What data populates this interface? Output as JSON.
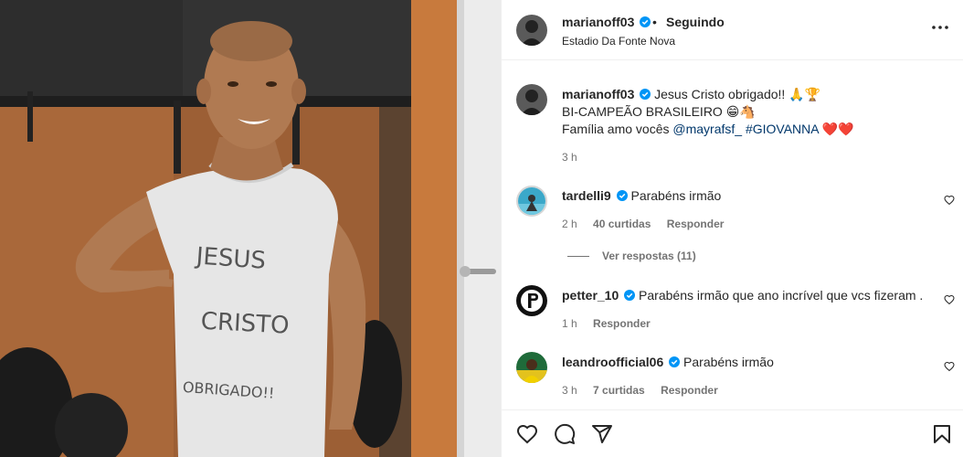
{
  "post": {
    "author": "marianoff03",
    "separator": "•",
    "follow_status": "Seguindo",
    "location": "Estadio Da Fonte Nova",
    "shirt_text": [
      "JESUS",
      "CRISTO",
      "OBRIGADO!!"
    ]
  },
  "caption": {
    "username": "marianoff03",
    "line1": "Jesus Cristo obrigado!! 🙏🏆",
    "line2": "BI-CAMPEÃO BRASILEIRO 😁🐴",
    "line3_prefix": "Família amo vocês ",
    "mention": "@mayrafsf_",
    "hashtag": "#GIOVANNA",
    "hearts": "❤️❤️",
    "time": "3 h"
  },
  "comments": [
    {
      "username": "tardelli9",
      "text": "Parabéns irmão",
      "time": "2 h",
      "likes": "40 curtidas",
      "reply": "Responder",
      "view_replies": "Ver respostas (11)"
    },
    {
      "username": "petter_10",
      "text": "Parabéns irmão que ano incrível que vcs fizeram .",
      "time": "1 h",
      "likes": "",
      "reply": "Responder"
    },
    {
      "username": "leandroofficial06",
      "text": "Parabéns irmão",
      "time": "3 h",
      "likes": "7 curtidas",
      "reply": "Responder"
    }
  ],
  "icons": {
    "verified": "verified-badge-icon",
    "more": "more-options-icon",
    "like": "heart-icon",
    "comment": "comment-icon",
    "share": "share-icon",
    "save": "bookmark-icon"
  },
  "colors": {
    "verified": "#0095f6",
    "link": "#00376b",
    "muted": "#737373",
    "heart_red": "#ed4956"
  }
}
